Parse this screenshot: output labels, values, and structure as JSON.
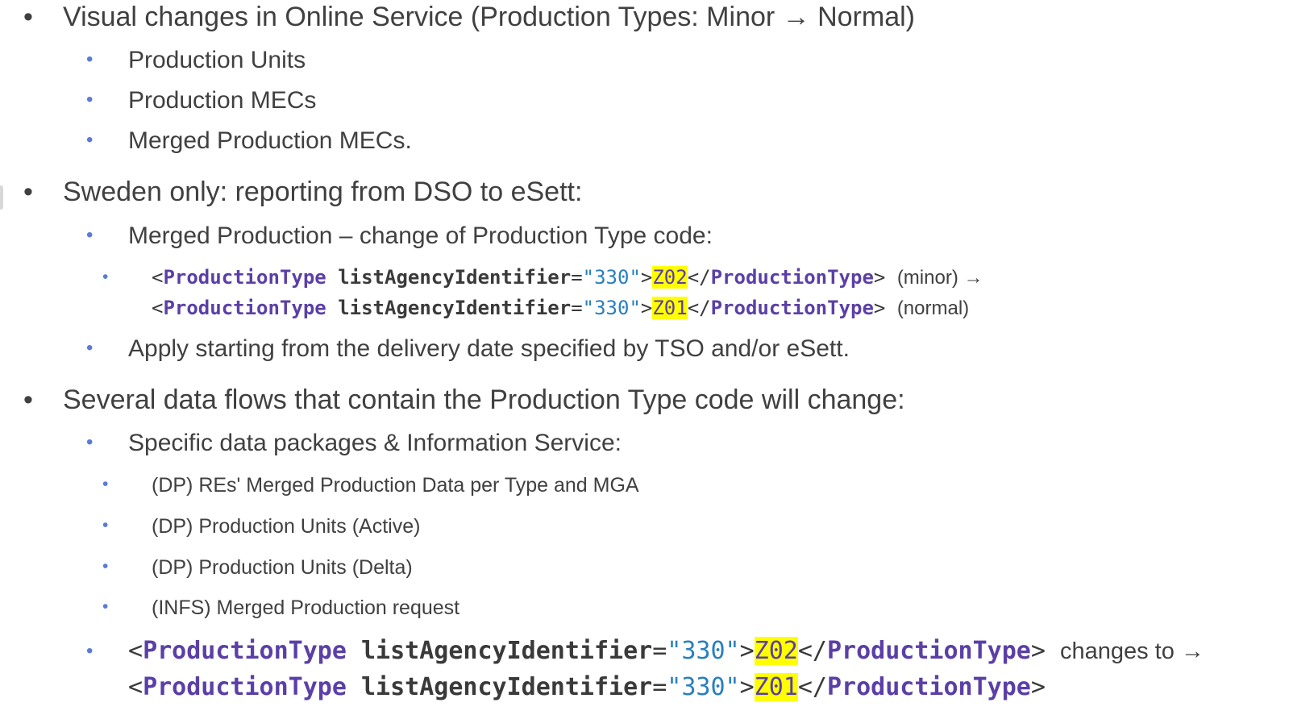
{
  "items": [
    {
      "text": "Visual changes in Online Service (Production Types: Minor → Normal)"
    },
    {
      "text": "Production Units"
    },
    {
      "text": "Production MECs"
    },
    {
      "text": "Merged Production MECs."
    },
    {
      "text": "Sweden only: reporting from DSO to eSett:"
    },
    {
      "text": "Merged Production – change of Production Type code:"
    },
    {
      "text": "Apply starting from the delivery date specified by TSO and/or eSett."
    },
    {
      "text": "Several data flows that contain the Production Type code will change:"
    },
    {
      "text": "Specific data packages & Information Service:"
    },
    {
      "text": "(DP) REs' Merged Production Data per Type and MGA"
    },
    {
      "text": "(DP) Production Units (Active)"
    },
    {
      "text": "(DP) Production Units (Delta)"
    },
    {
      "text": "(INFS) Merged Production request"
    }
  ],
  "code": {
    "open_lt": "<",
    "tag": "ProductionType",
    "attr": "listAgencyIdentifier",
    "eq": "=",
    "value": "\"330\"",
    "gt": ">",
    "close_open": "</",
    "old_code": "Z02",
    "new_code": "Z01",
    "note_minor": "(minor) →",
    "note_normal": "(normal)",
    "note_changes": "changes to →"
  },
  "bullet": "•"
}
